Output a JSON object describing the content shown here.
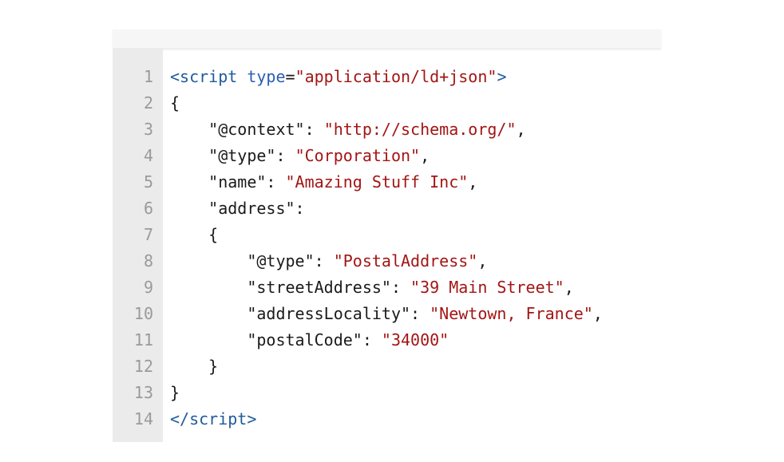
{
  "editor": {
    "lines": [
      {
        "n": "1",
        "tokens": [
          {
            "t": "<",
            "c": "tag"
          },
          {
            "t": "script",
            "c": "tag"
          },
          {
            "t": " ",
            "c": "punc"
          },
          {
            "t": "type",
            "c": "attr"
          },
          {
            "t": "=",
            "c": "punc"
          },
          {
            "t": "\"application/ld+json\"",
            "c": "str"
          },
          {
            "t": ">",
            "c": "tag"
          }
        ]
      },
      {
        "n": "2",
        "tokens": [
          {
            "t": "{",
            "c": "punc"
          }
        ]
      },
      {
        "n": "3",
        "tokens": [
          {
            "t": "    ",
            "c": "punc"
          },
          {
            "t": "\"@context\"",
            "c": "key"
          },
          {
            "t": ": ",
            "c": "punc"
          },
          {
            "t": "\"http://schema.org/\"",
            "c": "str"
          },
          {
            "t": ",",
            "c": "punc"
          }
        ]
      },
      {
        "n": "4",
        "tokens": [
          {
            "t": "    ",
            "c": "punc"
          },
          {
            "t": "\"@type\"",
            "c": "key"
          },
          {
            "t": ": ",
            "c": "punc"
          },
          {
            "t": "\"Corporation\"",
            "c": "str"
          },
          {
            "t": ",",
            "c": "punc"
          }
        ]
      },
      {
        "n": "5",
        "tokens": [
          {
            "t": "    ",
            "c": "punc"
          },
          {
            "t": "\"name\"",
            "c": "key"
          },
          {
            "t": ": ",
            "c": "punc"
          },
          {
            "t": "\"Amazing Stuff Inc\"",
            "c": "str"
          },
          {
            "t": ",",
            "c": "punc"
          }
        ]
      },
      {
        "n": "6",
        "tokens": [
          {
            "t": "    ",
            "c": "punc"
          },
          {
            "t": "\"address\"",
            "c": "key"
          },
          {
            "t": ":",
            "c": "punc"
          }
        ]
      },
      {
        "n": "7",
        "tokens": [
          {
            "t": "    {",
            "c": "punc"
          }
        ]
      },
      {
        "n": "8",
        "tokens": [
          {
            "t": "        ",
            "c": "punc"
          },
          {
            "t": "\"@type\"",
            "c": "key"
          },
          {
            "t": ": ",
            "c": "punc"
          },
          {
            "t": "\"PostalAddress\"",
            "c": "str"
          },
          {
            "t": ",",
            "c": "punc"
          }
        ]
      },
      {
        "n": "9",
        "tokens": [
          {
            "t": "        ",
            "c": "punc"
          },
          {
            "t": "\"streetAddress\"",
            "c": "key"
          },
          {
            "t": ": ",
            "c": "punc"
          },
          {
            "t": "\"39 Main Street\"",
            "c": "str"
          },
          {
            "t": ",",
            "c": "punc"
          }
        ]
      },
      {
        "n": "10",
        "tokens": [
          {
            "t": "        ",
            "c": "punc"
          },
          {
            "t": "\"addressLocality\"",
            "c": "key"
          },
          {
            "t": ": ",
            "c": "punc"
          },
          {
            "t": "\"Newtown, France\"",
            "c": "str"
          },
          {
            "t": ",",
            "c": "punc"
          }
        ]
      },
      {
        "n": "11",
        "tokens": [
          {
            "t": "        ",
            "c": "punc"
          },
          {
            "t": "\"postalCode\"",
            "c": "key"
          },
          {
            "t": ": ",
            "c": "punc"
          },
          {
            "t": "\"34000\"",
            "c": "str"
          }
        ]
      },
      {
        "n": "12",
        "tokens": [
          {
            "t": "    }",
            "c": "punc"
          }
        ]
      },
      {
        "n": "13",
        "tokens": [
          {
            "t": "}",
            "c": "punc"
          }
        ]
      },
      {
        "n": "14",
        "tokens": [
          {
            "t": "</",
            "c": "tag"
          },
          {
            "t": "script",
            "c": "tag"
          },
          {
            "t": ">",
            "c": "tag"
          }
        ]
      }
    ]
  },
  "colors": {
    "gutter_bg": "#ebebeb",
    "line_number": "#9a9a9a",
    "tag": "#1f5a9c",
    "attribute": "#2b5fb2",
    "string": "#a31515",
    "text": "#1a1a1a"
  }
}
